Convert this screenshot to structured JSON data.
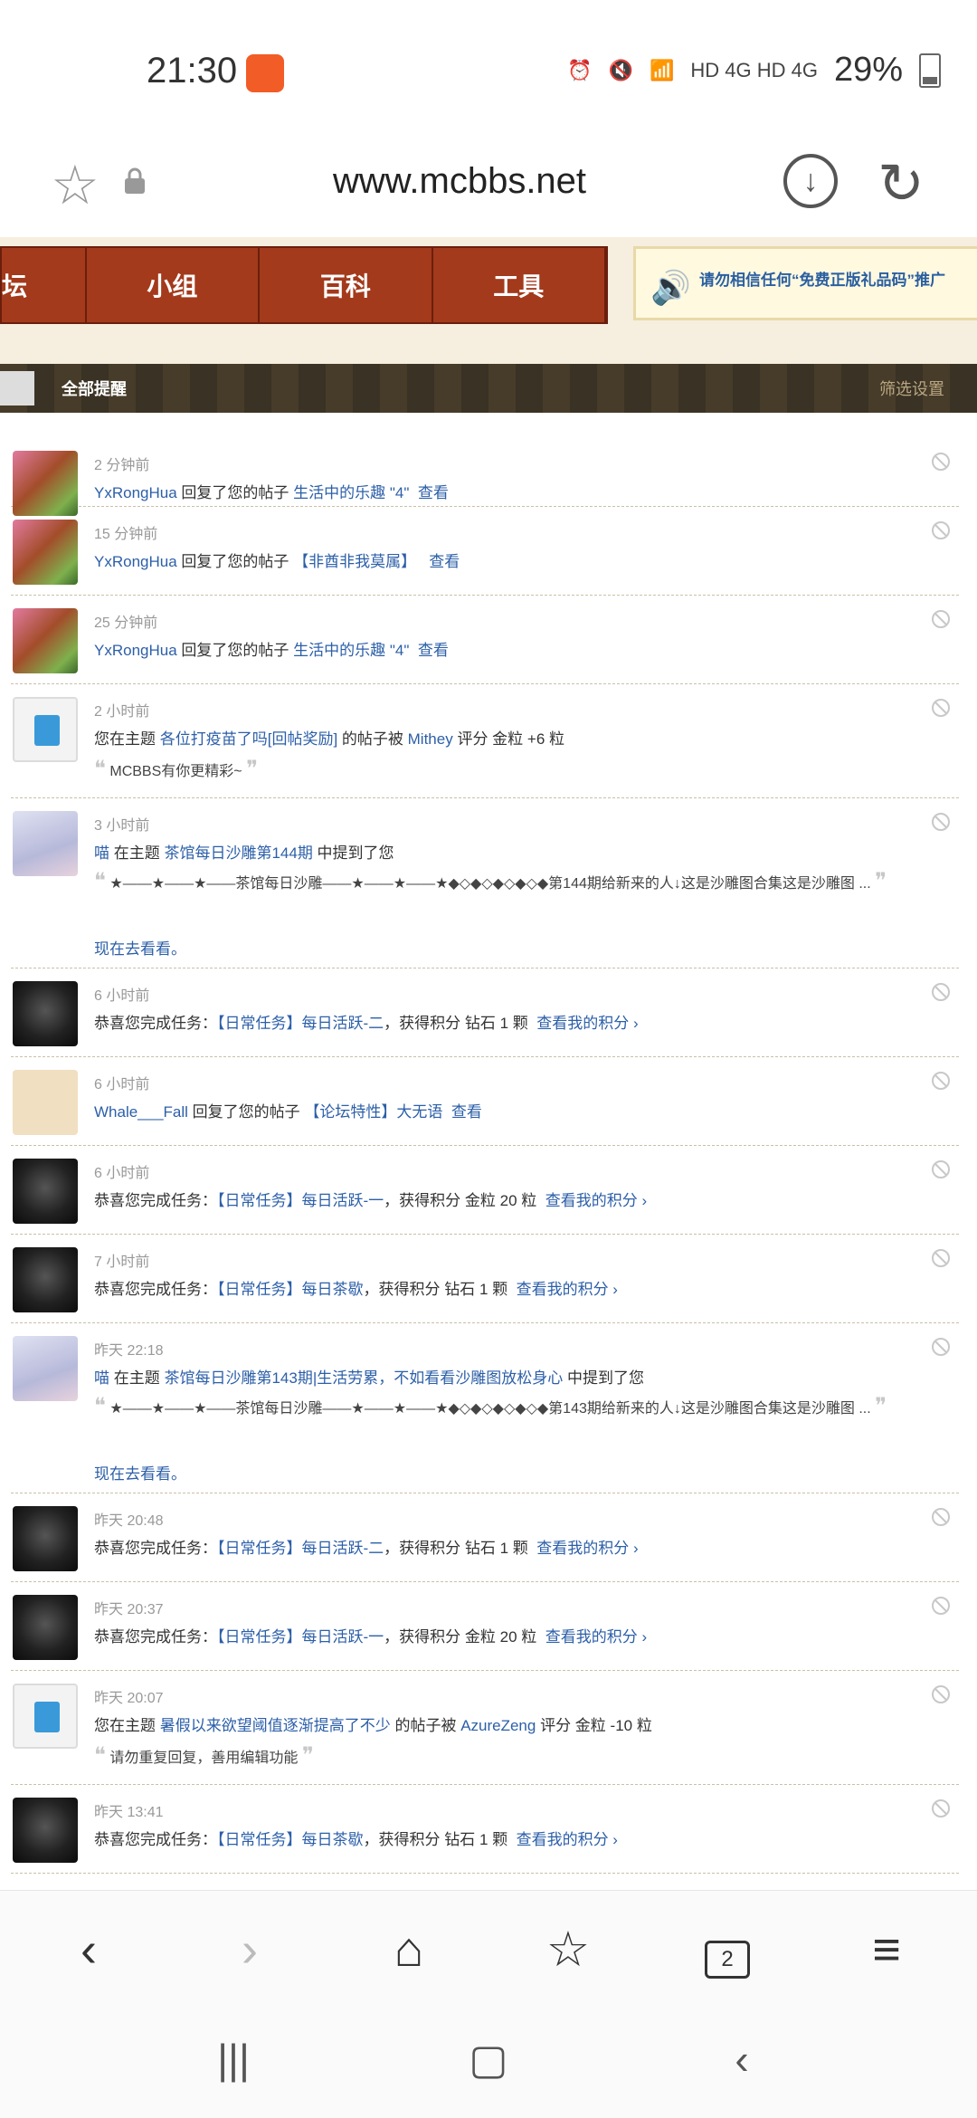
{
  "status": {
    "time": "21:30",
    "battery": "29%",
    "network": "HD 4G HD 4G"
  },
  "browser": {
    "url": "www.mcbbs.net",
    "tabs_count": "2"
  },
  "nav": {
    "partial": "坛",
    "items": [
      "小组",
      "百科",
      "工具"
    ]
  },
  "notice": {
    "text": "请勿相信任何“免费正版礼品码”推广"
  },
  "header": {
    "title": "全部提醒",
    "filter": "筛选设置"
  },
  "notifications": [
    {
      "time": "2 分钟前",
      "user": "YxRongHua",
      "action": " 回复了您的帖子 ",
      "target": "生活中的乐趣 \"4\"",
      "link": "查看"
    },
    {
      "time": "15 分钟前",
      "user": "YxRongHua",
      "action": " 回复了您的帖子 ",
      "target": "【非酋非我莫属】",
      "link": "查看"
    },
    {
      "time": "25 分钟前",
      "user": "YxRongHua",
      "action": " 回复了您的帖子 ",
      "target": "生活中的乐趣 \"4\"",
      "link": "查看"
    },
    {
      "time": "2 小时前",
      "pre": "您在主题 ",
      "target": "各位打疫苗了吗[回帖奖励]",
      "mid": " 的帖子被 ",
      "user": "Mithey",
      "post": " 评分 金粒 +6 粒",
      "quote": "MCBBS有你更精彩~"
    },
    {
      "time": "3 小时前",
      "user": "喵",
      "mid": " 在主题 ",
      "target": "茶馆每日沙雕第144期",
      "post": " 中提到了您",
      "quote": "★——★——★——茶馆每日沙雕——★——★——★◆◇◆◇◆◇◆◇◆第144期给新来的人↓这是沙雕图合集这是沙雕图 ...",
      "cta": "现在去看看。"
    },
    {
      "time": "6 小时前",
      "pre": "恭喜您完成任务：",
      "target": "【日常任务】每日活跃-二",
      "post": "，获得积分 钻石 1 颗",
      "link": "查看我的积分 ›"
    },
    {
      "time": "6 小时前",
      "user": "Whale___Fall",
      "action": " 回复了您的帖子 ",
      "target": "【论坛特性】大无语",
      "link": "查看"
    },
    {
      "time": "6 小时前",
      "pre": "恭喜您完成任务：",
      "target": "【日常任务】每日活跃-一",
      "post": "，获得积分 金粒 20 粒",
      "link": "查看我的积分 ›"
    },
    {
      "time": "7 小时前",
      "pre": "恭喜您完成任务：",
      "target": "【日常任务】每日茶歇",
      "post": "，获得积分 钻石 1 颗",
      "link": "查看我的积分 ›"
    },
    {
      "time": "昨天 22:18",
      "user": "喵",
      "mid": " 在主题 ",
      "target": "茶馆每日沙雕第143期|生活劳累，不如看看沙雕图放松身心",
      "post": " 中提到了您",
      "quote": "★——★——★——茶馆每日沙雕——★——★——★◆◇◆◇◆◇◆◇◆第143期给新来的人↓这是沙雕图合集这是沙雕图 ...",
      "cta": "现在去看看。"
    },
    {
      "time": "昨天 20:48",
      "pre": "恭喜您完成任务：",
      "target": "【日常任务】每日活跃-二",
      "post": "，获得积分 钻石 1 颗",
      "link": "查看我的积分 ›"
    },
    {
      "time": "昨天 20:37",
      "pre": "恭喜您完成任务：",
      "target": "【日常任务】每日活跃-一",
      "post": "，获得积分 金粒 20 粒",
      "link": "查看我的积分 ›"
    },
    {
      "time": "昨天 20:07",
      "pre": "您在主题 ",
      "target": "暑假以来欲望阈值逐渐提高了不少",
      "mid": " 的帖子被 ",
      "user": "AzureZeng",
      "post": " 评分 金粒 -10 粒",
      "quote": "请勿重复回复，善用编辑功能"
    },
    {
      "time": "昨天 13:41",
      "pre": "恭喜您完成任务：",
      "target": "【日常任务】每日茶歇",
      "post": "，获得积分 钻石 1 颗",
      "link": "查看我的积分 ›"
    }
  ]
}
